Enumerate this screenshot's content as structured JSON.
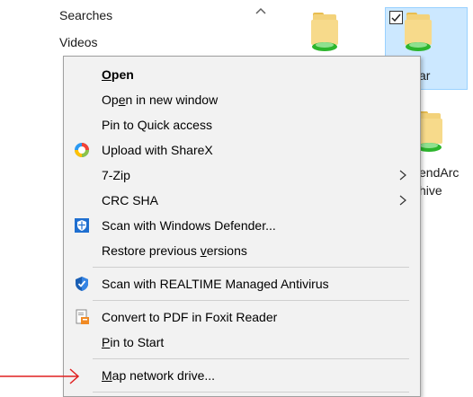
{
  "nav": {
    "items": [
      "Searches",
      "Videos"
    ]
  },
  "files": {
    "selected_label_fragment": "ar",
    "second_label_line1": "endArc",
    "second_label_line2": "hive"
  },
  "context_menu": {
    "open": {
      "pre": "",
      "mn": "O",
      "post": "pen"
    },
    "open_new_window": {
      "pre": "Op",
      "mn": "e",
      "post": "n in new window"
    },
    "pin_quick_access": "Pin to Quick access",
    "upload_sharex": "Upload with ShareX",
    "seven_zip": "7-Zip",
    "crc_sha": "CRC SHA",
    "scan_defender": "Scan with Windows Defender...",
    "restore_versions": {
      "pre": "Restore previous ",
      "mn": "v",
      "post": "ersions"
    },
    "scan_realtime": "Scan with REALTIME Managed Antivirus",
    "convert_pdf": "Convert to PDF in Foxit Reader",
    "pin_start": {
      "pre": "",
      "mn": "P",
      "post": "in to Start"
    },
    "map_network": {
      "pre": "",
      "mn": "M",
      "post": "ap network drive..."
    }
  },
  "colors": {
    "menu_bg": "#f2f2f2",
    "selection_bg": "#cce8ff",
    "annotation_arrow": "#e02020"
  }
}
